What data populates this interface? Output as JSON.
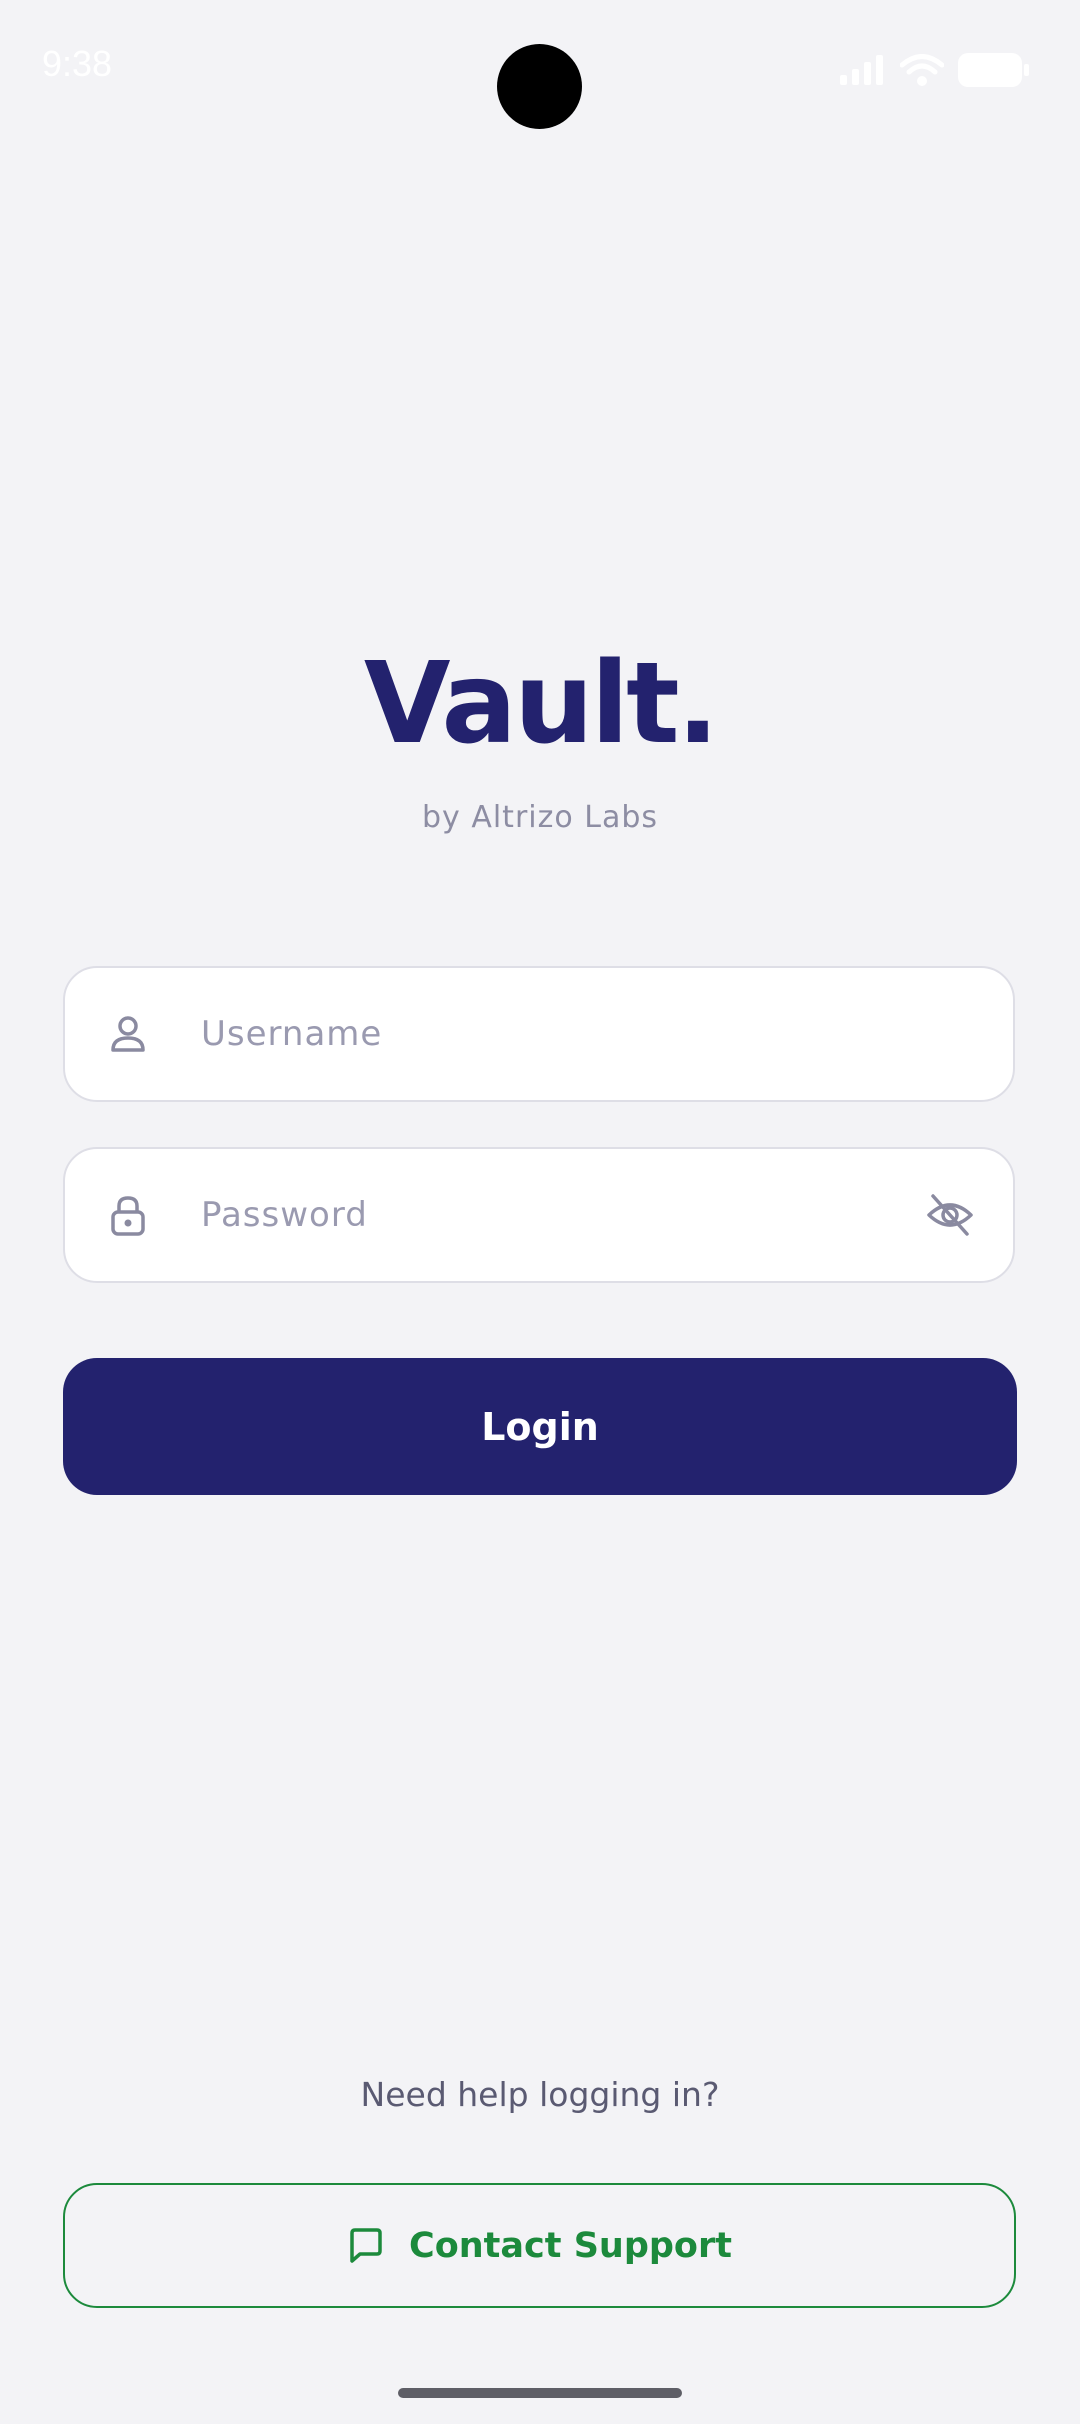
{
  "status_bar": {
    "time": "9:38",
    "icons": [
      "signal-icon",
      "wifi-icon",
      "battery-icon"
    ]
  },
  "brand": {
    "title": "Vault.",
    "subtitle": "by Altrizo Labs"
  },
  "login_form": {
    "username": {
      "placeholder": "Username",
      "value": "",
      "icon": "user-icon"
    },
    "password": {
      "placeholder": "Password",
      "value": "",
      "icon": "lock-icon",
      "toggle_icon": "eye-off-icon"
    },
    "login_label": "Login"
  },
  "help": {
    "text": "Need help logging in?",
    "support_label": "Contact Support",
    "support_icon": "chat-bubble-icon"
  },
  "colors": {
    "background": "#f3f3f6",
    "brand_primary": "#23226e",
    "support_green": "#1c8a3c",
    "muted_text": "#8d8da3"
  }
}
